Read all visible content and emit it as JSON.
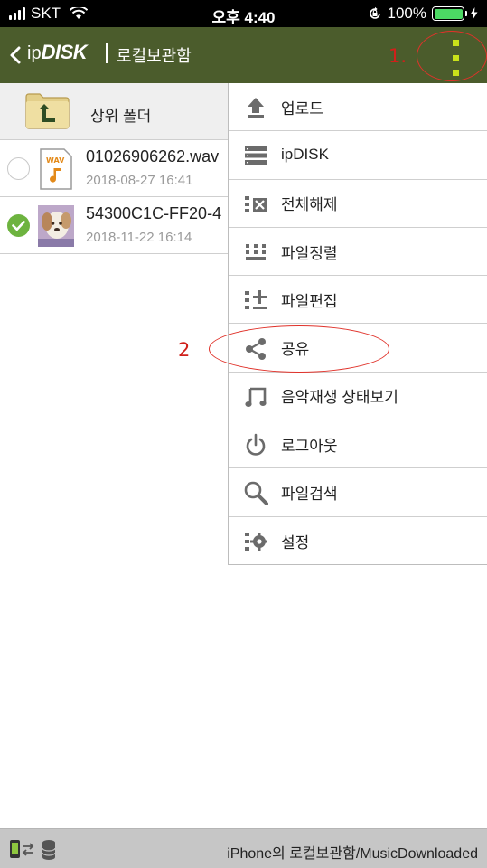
{
  "status_bar": {
    "carrier": "SKT",
    "time": "오후 4:40",
    "battery_percent": "100%",
    "battery_level": 1.0,
    "battery_color": "#4cd964"
  },
  "nav": {
    "back_icon": "chevron-left-icon",
    "brand_prefix": "ip",
    "brand_name": "DISK",
    "title": "로컬보관함",
    "more_icon": "vertical-dots-icon",
    "bar_color": "#4b5c2c",
    "accent_color": "#c9e21a"
  },
  "file_list": {
    "up_folder_label": "상위 폴더",
    "files": [
      {
        "name": "01026906262.wav",
        "date": "2018-08-27 16:41",
        "selected": false,
        "thumb": "wav-file-icon"
      },
      {
        "name": "54300C1C-FF20-4",
        "date": "2018-11-22 16:14",
        "selected": true,
        "thumb": "photo-thumbnail"
      }
    ]
  },
  "menu": {
    "items": [
      {
        "label": "업로드",
        "icon": "upload-icon"
      },
      {
        "label": "ipDISK",
        "icon": "server-icon"
      },
      {
        "label": "전체해제",
        "icon": "deselect-all-icon"
      },
      {
        "label": "파일정렬",
        "icon": "sort-grid-icon"
      },
      {
        "label": "파일편집",
        "icon": "edit-list-icon"
      },
      {
        "label": "공유",
        "icon": "share-icon"
      },
      {
        "label": "음악재생 상태보기",
        "icon": "music-note-icon"
      },
      {
        "label": "로그아웃",
        "icon": "power-icon"
      },
      {
        "label": "파일검색",
        "icon": "search-icon"
      },
      {
        "label": "설정",
        "icon": "settings-icon"
      }
    ]
  },
  "annotations": {
    "step1": "1.",
    "step2": "2",
    "color": "#d0201a"
  },
  "bottom_bar": {
    "path": "iPhone의 로컬보관함/MusicDownloaded"
  }
}
